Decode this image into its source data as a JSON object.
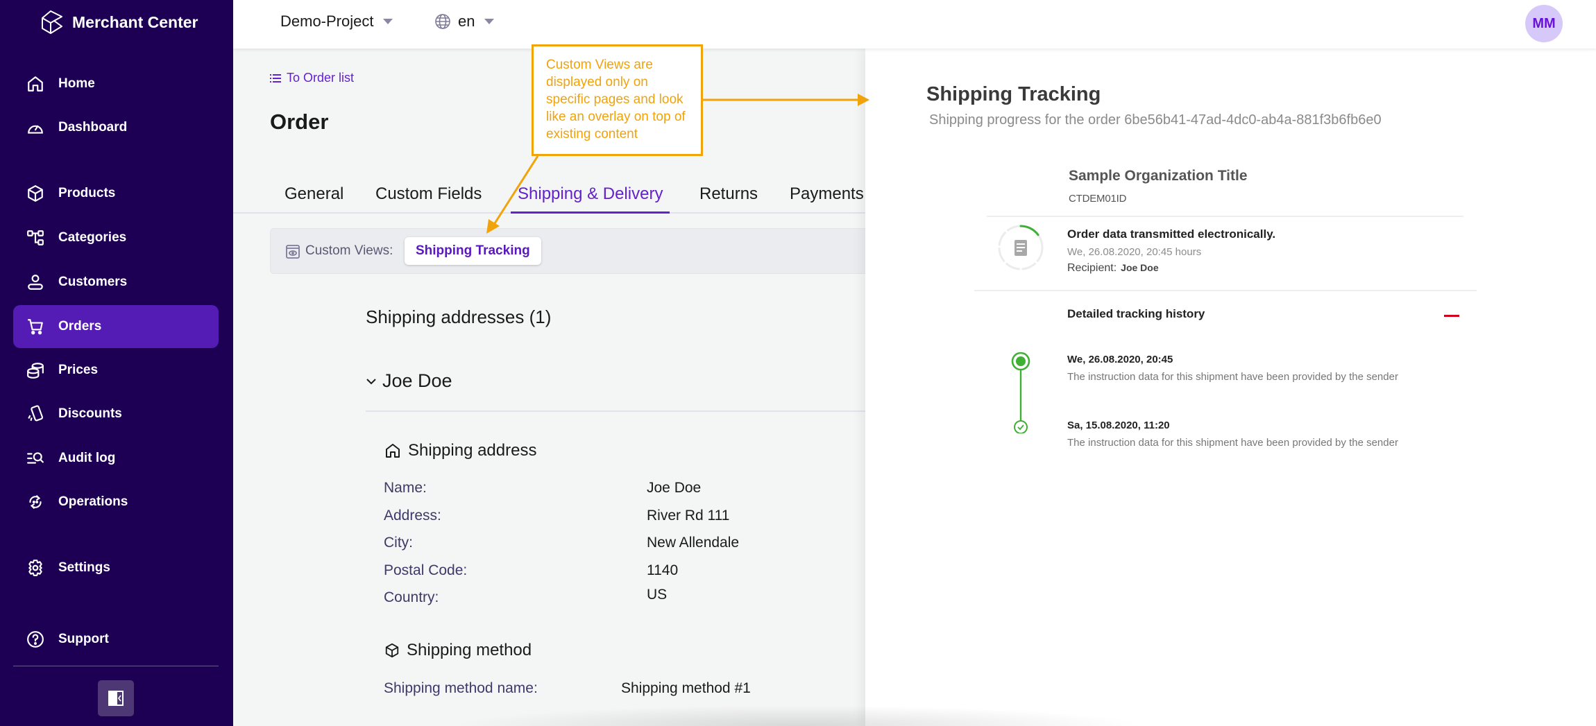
{
  "app": {
    "brand": "Merchant Center",
    "project": "Demo-Project",
    "language": "en",
    "user_initials": "MM"
  },
  "sidebar": {
    "items": [
      {
        "label": "Home",
        "icon": "home-icon",
        "active": false
      },
      {
        "label": "Dashboard",
        "icon": "dashboard-icon",
        "active": false
      },
      {
        "label": "Products",
        "icon": "cube-icon",
        "active": false
      },
      {
        "label": "Categories",
        "icon": "tree-icon",
        "active": false
      },
      {
        "label": "Customers",
        "icon": "user-icon",
        "active": false
      },
      {
        "label": "Orders",
        "icon": "cart-icon",
        "active": true
      },
      {
        "label": "Prices",
        "icon": "coins-icon",
        "active": false
      },
      {
        "label": "Discounts",
        "icon": "discount-icon",
        "active": false
      },
      {
        "label": "Audit log",
        "icon": "audit-search-icon",
        "active": false
      },
      {
        "label": "Operations",
        "icon": "operations-icon",
        "active": false
      },
      {
        "label": "Settings",
        "icon": "gear-icon",
        "active": false
      },
      {
        "label": "Support",
        "icon": "help-icon",
        "active": false
      }
    ],
    "collapse_icon": "sidebar-collapse-icon"
  },
  "main": {
    "back_link": "To Order list",
    "title": "Order",
    "tabs": [
      {
        "label": "General",
        "active": false
      },
      {
        "label": "Custom Fields",
        "active": false
      },
      {
        "label": "Shipping & Delivery",
        "active": true
      },
      {
        "label": "Returns",
        "active": false
      },
      {
        "label": "Payments",
        "active": false
      }
    ],
    "custom_views": {
      "label": "Custom Views:",
      "button": "Shipping Tracking"
    },
    "shipping_addresses_title": "Shipping addresses (1)",
    "address_name_toggle": "Joe Doe",
    "shipping_address": {
      "title": "Shipping address",
      "fields": [
        {
          "label": "Name:",
          "value": "Joe Doe"
        },
        {
          "label": "Address:",
          "value": "River Rd 111"
        },
        {
          "label": "City:",
          "value": "New Allendale"
        },
        {
          "label": "Postal Code:",
          "value": "1140"
        },
        {
          "label": "Country:",
          "value": "US"
        }
      ]
    },
    "shipping_method": {
      "title": "Shipping method",
      "fields": [
        {
          "label": "Shipping method name:",
          "value": "Shipping method #1"
        }
      ]
    }
  },
  "overlay": {
    "title": "Shipping Tracking",
    "subtitle": "Shipping progress for the order 6be56b41-47ad-4dc0-ab4a-881f3b6fb6e0",
    "organization": "Sample Organization Title",
    "organization_id": "CTDEM01ID",
    "status": {
      "title": "Order data transmitted electronically.",
      "date": "We, 26.08.2020, 20:45 hours",
      "recipient_label": "Recipient:",
      "recipient": "Joe Doe",
      "progress": 0.15
    },
    "history_title": "Detailed tracking history",
    "events": [
      {
        "date": "We, 26.08.2020, 20:45",
        "description": "The instruction data for this shipment have been provided by the sender"
      },
      {
        "date": "Sa, 15.08.2020, 11:20",
        "description": "The instruction data for this shipment have been provided by the sender"
      }
    ]
  },
  "annotation": {
    "text": "Custom Views are displayed only on specific pages and look like an overlay on top of existing content",
    "color": "#f0a30a"
  },
  "colors": {
    "sidebar_bg": "#1d0053",
    "sidebar_active": "#541bb5",
    "accent": "#6222cc",
    "tracking_green": "#3fb034",
    "collapse_red": "#d0021b"
  }
}
